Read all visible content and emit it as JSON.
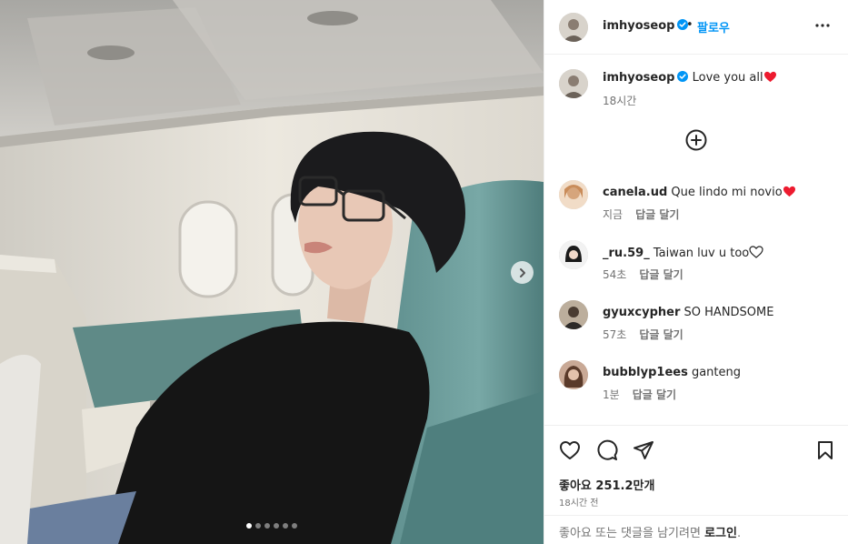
{
  "post": {
    "photo_alt": "",
    "carousel": {
      "total": 6,
      "active": 0
    }
  },
  "header": {
    "username": "imhyoseop",
    "separator": "•",
    "follow_label": "팔로우"
  },
  "caption": {
    "username": "imhyoseop",
    "text": "Love you all",
    "time": "18시간"
  },
  "comments": [
    {
      "username": "canela.ud",
      "text": "Que lindo mi novio",
      "heart": "red",
      "time": "지금",
      "reply": "답글 달기"
    },
    {
      "username": "_ru.59_",
      "text": "Taiwan luv u too",
      "heart": "outline",
      "time": "54초",
      "reply": "답글 달기"
    },
    {
      "username": "gyuxcypher",
      "text": "SO HANDSOME",
      "heart": "",
      "time": "57초",
      "reply": "답글 달기"
    },
    {
      "username": "bubblyp1ees",
      "text": "ganteng",
      "heart": "",
      "time": "1분",
      "reply": "답글 달기"
    }
  ],
  "actions": {
    "likes": "좋아요 251.2만개",
    "posted": "18시간 전"
  },
  "login": {
    "prompt": "좋아요 또는 댓글을 남기려면 ",
    "link": "로그인",
    "suffix": "."
  },
  "colors": {
    "link_blue": "#0095f6",
    "heart_red": "#ed1b2f",
    "text_primary": "#262626",
    "text_secondary": "#737373",
    "border": "#efefef"
  },
  "icons": [
    "verified-badge-icon",
    "more-options-icon",
    "plus-circle-icon",
    "heart-icon",
    "comment-icon",
    "share-icon",
    "bookmark-icon",
    "chevron-right-icon"
  ]
}
